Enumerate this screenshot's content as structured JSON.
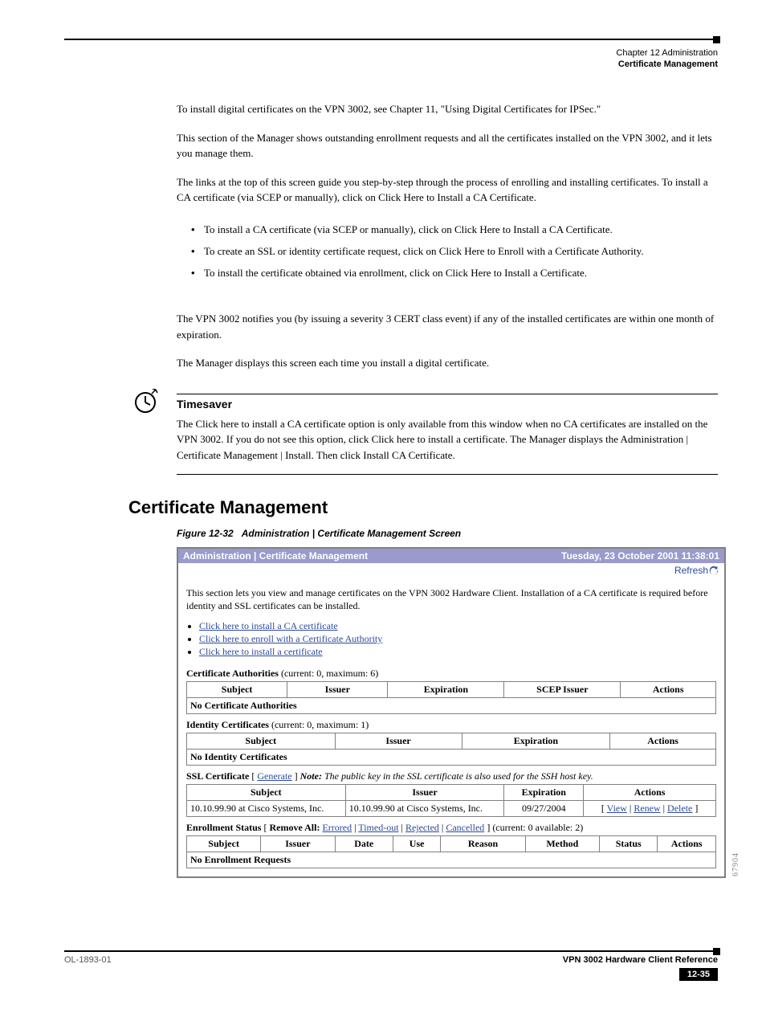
{
  "header": {
    "chapter": "Chapter 12      Administration",
    "section": "Certificate Management"
  },
  "intro": {
    "p1": "To install digital certificates on the VPN 3002, see Chapter 11, \"Using Digital Certificates for IPSec.\"",
    "p2": "This section of the Manager shows outstanding enrollment requests and all the certificates installed on the VPN 3002, and it lets you manage them.",
    "p3": "The links at the top of this screen guide you step-by-step through the process of enrolling and installing certificates. To install a CA certificate (via SCEP or manually), click on Click Here to Install a CA Certificate.",
    "bullets": [
      "To install a CA certificate (via SCEP or manually), click on Click Here to Install a CA Certificate.",
      "To create an SSL or identity certificate request, click on Click Here to Enroll with a Certificate Authority.",
      "To install the certificate obtained via enrollment, click on Click Here to Install a Certificate."
    ],
    "p4": "The VPN 3002 notifies you (by issuing a severity 3 CERT class event) if any of the installed certificates are within one month of expiration.",
    "p5": "The Manager displays this screen each time you install a digital certificate."
  },
  "timesaver": {
    "title": "Timesaver",
    "body": "The Click here to install a CA certificate option is only available from this window when no CA certificates are installed on the VPN 3002. If you do not see this option, click Click here to install a certificate. The Manager displays the Administration | Certificate Management | Install. Then click Install CA Certificate."
  },
  "section_title": "Certificate Management",
  "figure": {
    "num": "Figure 12-32",
    "title": "Administration | Certificate Management Screen"
  },
  "screenshot": {
    "breadcrumb": "Administration | Certificate Management",
    "timestamp": "Tuesday, 23 October 2001 11:38:01",
    "refresh": "Refresh",
    "intro": "This section lets you view and manage certificates on the VPN 3002 Hardware Client. Installation of a CA certificate is required before identity and SSL certificates can be installed.",
    "links": [
      "Click here to install a CA certificate",
      "Click here to enroll with a Certificate Authority",
      "Click here to install a certificate"
    ],
    "ca": {
      "title": "Certificate Authorities",
      "status": "(current: 0, maximum: 6)",
      "cols": [
        "Subject",
        "Issuer",
        "Expiration",
        "SCEP Issuer",
        "Actions"
      ],
      "empty": "No Certificate Authorities"
    },
    "identity": {
      "title": "Identity Certificates",
      "status": "(current: 0, maximum: 1)",
      "cols": [
        "Subject",
        "Issuer",
        "Expiration",
        "Actions"
      ],
      "empty": "No Identity Certificates"
    },
    "ssl": {
      "title": "SSL Certificate",
      "gen": "Generate",
      "note_label": "Note:",
      "note": "The public key in the SSL certificate is also used for the SSH host key.",
      "cols": [
        "Subject",
        "Issuer",
        "Expiration",
        "Actions"
      ],
      "row": {
        "subject": "10.10.99.90 at Cisco Systems, Inc.",
        "issuer": "10.10.99.90 at Cisco Systems, Inc.",
        "expiration": "09/27/2004",
        "actions": [
          "View",
          "Renew",
          "Delete"
        ]
      }
    },
    "enroll": {
      "title": "Enrollment Status",
      "remove_label": "Remove All:",
      "remove_links": [
        "Errored",
        "Timed-out",
        "Rejected",
        "Cancelled"
      ],
      "status": "(current: 0 available: 2)",
      "cols": [
        "Subject",
        "Issuer",
        "Date",
        "Use",
        "Reason",
        "Method",
        "Status",
        "Actions"
      ],
      "empty": "No Enrollment Requests"
    },
    "image_number": "67904"
  },
  "footer": {
    "book": "VPN 3002 Hardware Client Reference",
    "ref": "OL-1893-01",
    "page": "12-35"
  }
}
